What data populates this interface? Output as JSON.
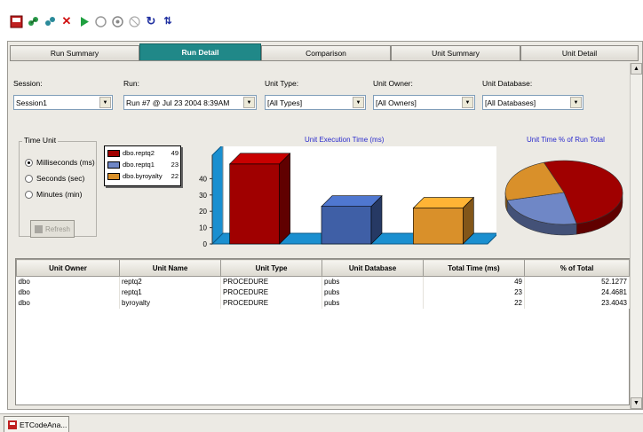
{
  "toolbar": {
    "icons": [
      "app-icon",
      "connect-icon",
      "disconnect-icon",
      "delete-icon",
      "run-icon",
      "stop-icon",
      "options-icon",
      "clear-icon",
      "refresh-icon",
      "sort-icon"
    ]
  },
  "tabs": [
    {
      "label": "Run Summary",
      "active": false
    },
    {
      "label": "Run Detail",
      "active": true
    },
    {
      "label": "Comparison",
      "active": false
    },
    {
      "label": "Unit Summary",
      "active": false
    },
    {
      "label": "Unit Detail",
      "active": false
    }
  ],
  "filters": {
    "session": {
      "label": "Session:",
      "value": "Session1"
    },
    "run": {
      "label": "Run:",
      "value": "Run #7 @ Jul 23 2004  8:39AM"
    },
    "unit_type": {
      "label": "Unit Type:",
      "value": "[All Types]"
    },
    "unit_owner": {
      "label": "Unit Owner:",
      "value": "[All Owners]"
    },
    "unit_database": {
      "label": "Unit Database:",
      "value": "[All Databases]"
    }
  },
  "time_unit": {
    "title": "Time Unit",
    "options": [
      {
        "label": "Milliseconds (ms)",
        "checked": true
      },
      {
        "label": "Seconds (sec)",
        "checked": false
      },
      {
        "label": "Minutes (min)",
        "checked": false
      }
    ],
    "refresh_label": "Refresh"
  },
  "legend": [
    {
      "label": "dbo.reptq2",
      "value": "49",
      "color": "#a00000"
    },
    {
      "label": "dbo.reptq1",
      "value": "23",
      "color": "#6f87c6"
    },
    {
      "label": "dbo.byroyalty",
      "value": "22",
      "color": "#d9902a"
    }
  ],
  "chart_data": [
    {
      "type": "bar",
      "title": "Unit Execution Time (ms)",
      "categories": [
        "dbo.reptq2",
        "dbo.reptq1",
        "dbo.byroyalty"
      ],
      "values": [
        49,
        23,
        22
      ],
      "ylim": [
        0,
        50
      ],
      "yticks": [
        "0",
        "10",
        "20",
        "30",
        "40"
      ],
      "colors": [
        "#a00000",
        "#3f5fa6",
        "#d9902a"
      ],
      "grid": false
    },
    {
      "type": "pie",
      "title": "Unit Time % of Run Total",
      "labels": [
        "dbo.reptq2",
        "dbo.reptq1",
        "dbo.byroyalty"
      ],
      "values": [
        52.1277,
        24.4681,
        23.4043
      ],
      "colors": [
        "#a00000",
        "#6f87c6",
        "#d9902a"
      ]
    }
  ],
  "grid": {
    "columns": [
      "Unit Owner",
      "Unit Name",
      "Unit Type",
      "Unit Database",
      "Total Time (ms)",
      "% of Total"
    ],
    "rows": [
      [
        "dbo",
        "reptq2",
        "PROCEDURE",
        "pubs",
        "49",
        "52.1277"
      ],
      [
        "dbo",
        "reptq1",
        "PROCEDURE",
        "pubs",
        "23",
        "24.4681"
      ],
      [
        "dbo",
        "byroyalty",
        "PROCEDURE",
        "pubs",
        "22",
        "23.4043"
      ]
    ]
  },
  "taskbar": {
    "label": "ETCodeAna..."
  }
}
